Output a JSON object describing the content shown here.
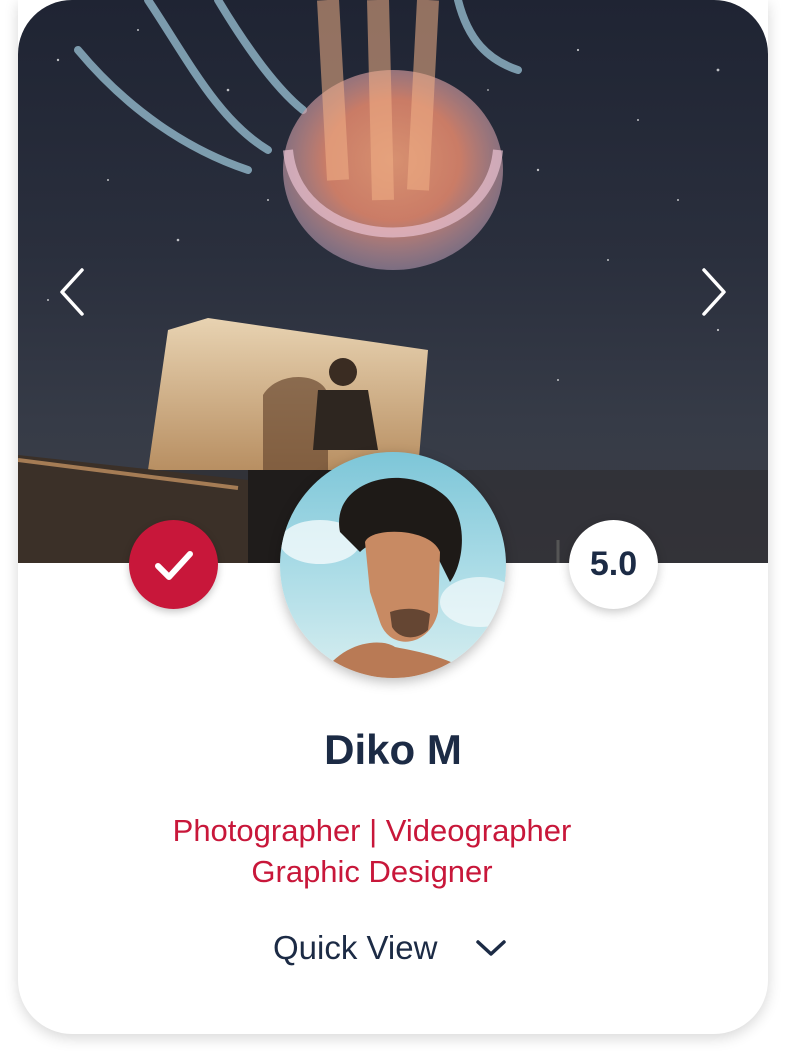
{
  "profile": {
    "name": "Diko M",
    "roles_line1": "Photographer | Videographer",
    "roles_line2": "Graphic Designer",
    "rating": "5.0",
    "verified": true
  },
  "actions": {
    "quick_view_label": "Quick View"
  },
  "icons": {
    "prev": "chevron-left-icon",
    "next": "chevron-right-icon",
    "verified": "check-icon",
    "expand": "chevron-down-icon"
  },
  "colors": {
    "accent": "#c8173a",
    "text_dark": "#1c2b45",
    "card_bg": "#ffffff"
  }
}
